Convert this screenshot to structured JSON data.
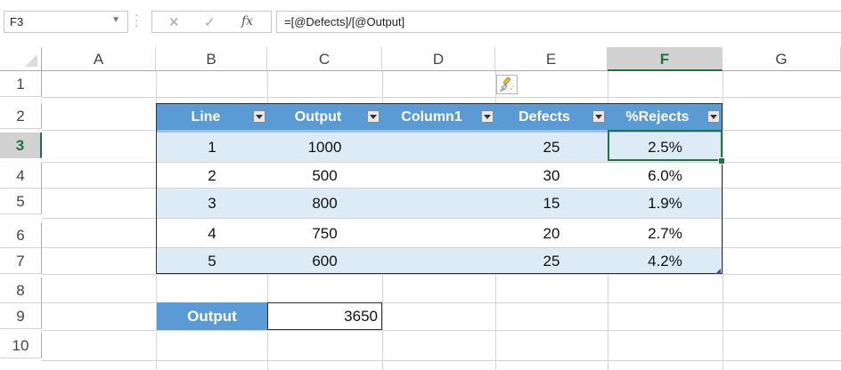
{
  "formula_bar": {
    "name_box": "F3",
    "cancel_glyph": "✕",
    "enter_glyph": "✓",
    "fx_label": "fx",
    "formula": "=[@Defects]/[@Output]"
  },
  "columns": [
    "A",
    "B",
    "C",
    "D",
    "E",
    "F",
    "G"
  ],
  "rows": [
    "1",
    "2",
    "3",
    "4",
    "5",
    "6",
    "7",
    "8",
    "9",
    "10"
  ],
  "selected_cell": "F3",
  "table": {
    "headers": [
      "Line",
      "Output",
      "Column1",
      "Defects",
      "%Rejects"
    ],
    "rows": [
      [
        "1",
        "1000",
        "",
        "25",
        "2.5%"
      ],
      [
        "2",
        "500",
        "",
        "30",
        "6.0%"
      ],
      [
        "3",
        "800",
        "",
        "15",
        "1.9%"
      ],
      [
        "4",
        "750",
        "",
        "20",
        "2.7%"
      ],
      [
        "5",
        "600",
        "",
        "25",
        "4.2%"
      ]
    ],
    "header_color": "#5b9bd5",
    "band_color": "#ddebf7"
  },
  "summary": {
    "label": "Output",
    "value": "3650"
  },
  "icons": {
    "paint_brush": "paintbrush-icon"
  },
  "colors": {
    "selection": "#217346"
  }
}
